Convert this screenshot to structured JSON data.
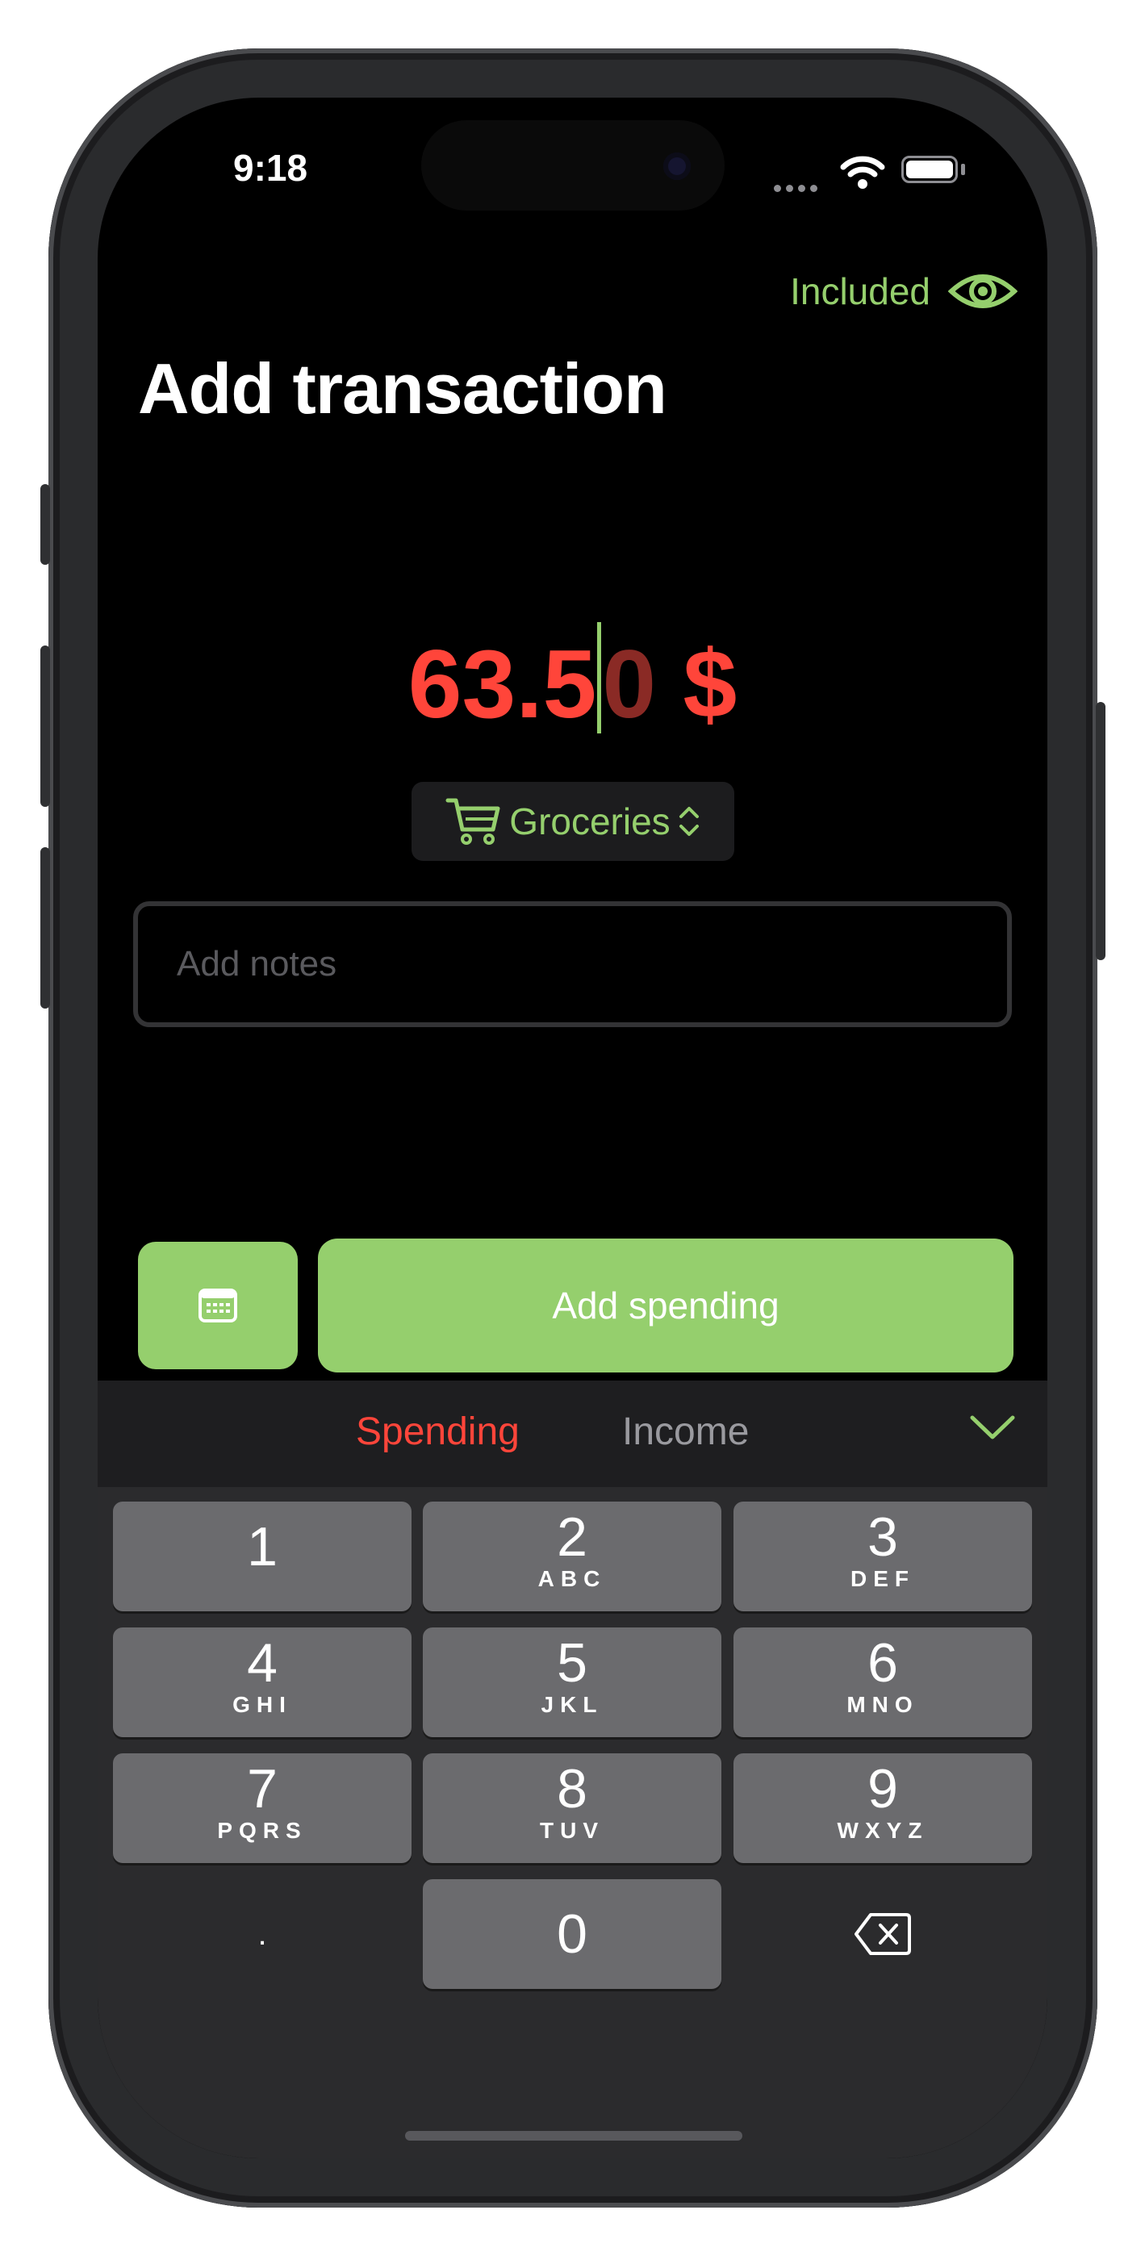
{
  "status_bar": {
    "time": "9:18"
  },
  "header": {
    "included_label": "Included",
    "title": "Add transaction"
  },
  "amount": {
    "main": "63.5",
    "trailing": "0",
    "currency": " $"
  },
  "category": {
    "label": "Groceries"
  },
  "notes": {
    "placeholder": "Add notes"
  },
  "actions": {
    "add_label": "Add spending"
  },
  "keyboard": {
    "tabs": {
      "spending": "Spending",
      "income": "Income"
    },
    "keys": [
      {
        "num": "1",
        "letters": ""
      },
      {
        "num": "2",
        "letters": "ABC"
      },
      {
        "num": "3",
        "letters": "DEF"
      },
      {
        "num": "4",
        "letters": "GHI"
      },
      {
        "num": "5",
        "letters": "JKL"
      },
      {
        "num": "6",
        "letters": "MNO"
      },
      {
        "num": "7",
        "letters": "PQRS"
      },
      {
        "num": "8",
        "letters": "TUV"
      },
      {
        "num": "9",
        "letters": "WXYZ"
      }
    ],
    "decimal": ".",
    "zero": "0"
  },
  "colors": {
    "accent_green": "#95cf6d",
    "spending_red": "#ff453a",
    "background": "#000000"
  },
  "icons": [
    "eye-icon",
    "cart-icon",
    "chevron-updown-icon",
    "calendar-icon",
    "checkmark-icon",
    "delete-backspace-icon",
    "wifi-icon",
    "battery-icon"
  ]
}
